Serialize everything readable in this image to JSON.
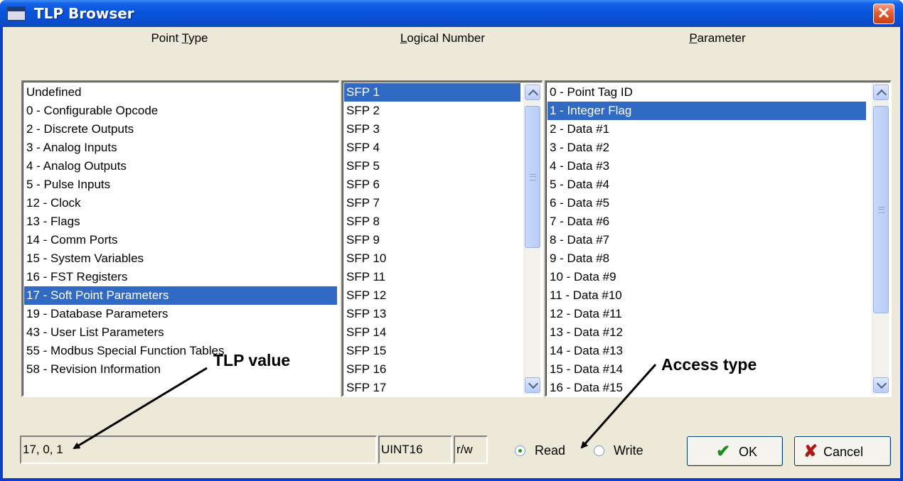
{
  "window": {
    "title": "TLP Browser",
    "close_glyph": "✕"
  },
  "columns": {
    "point_type": {
      "pre": "Point ",
      "accel": "T",
      "post": "ype"
    },
    "logical_number": {
      "pre": "",
      "accel": "L",
      "post": "ogical Number"
    },
    "parameter": {
      "pre": "",
      "accel": "P",
      "post": "arameter"
    }
  },
  "point_types": {
    "items": [
      "Undefined",
      "0 - Configurable Opcode",
      "2 - Discrete Outputs",
      "3 - Analog Inputs",
      "4 - Analog Outputs",
      "5 - Pulse Inputs",
      "12 - Clock",
      "13 - Flags",
      "14 - Comm Ports",
      "15 - System Variables",
      "16 - FST Registers",
      "17 - Soft Point Parameters",
      "19 - Database Parameters",
      "43 - User List Parameters",
      "55 - Modbus Special Function Tables",
      "58 - Revision Information"
    ],
    "selected_index": 11
  },
  "logical_numbers": {
    "items": [
      "SFP 1",
      "SFP 2",
      "SFP 3",
      "SFP 4",
      "SFP 5",
      "SFP 6",
      "SFP 7",
      "SFP 8",
      "SFP 9",
      "SFP 10",
      "SFP 11",
      "SFP 12",
      "SFP 13",
      "SFP 14",
      "SFP 15",
      "SFP 16",
      "SFP 17"
    ],
    "selected_index": 0
  },
  "parameters": {
    "items": [
      "0 - Point Tag ID",
      "1 - Integer Flag",
      "2 - Data #1",
      "3 - Data #2",
      "4 - Data #3",
      "5 - Data #4",
      "6 - Data #5",
      "7 - Data #6",
      "8 - Data #7",
      "9 - Data #8",
      "10 - Data #9",
      "11 - Data #10",
      "12 - Data #11",
      "13 - Data #12",
      "14 - Data #13",
      "15 - Data #14",
      "16 - Data #15"
    ],
    "selected_index": 1
  },
  "status": {
    "tlp_value": "17, 0, 1",
    "data_type": "UINT16",
    "access": "r/w"
  },
  "access_mode": {
    "read_label": "Read",
    "write_label": "Write",
    "selected": "read"
  },
  "buttons": {
    "ok_label": "OK",
    "ok_icon": "✔",
    "cancel_label": "Cancel",
    "cancel_icon": "✘"
  },
  "annotations": {
    "tlp_value": "TLP value",
    "access_type": "Access type"
  },
  "colors": {
    "selection": "#316ac5",
    "ok_check": "#1e8c1e",
    "cancel_x": "#b01818"
  }
}
